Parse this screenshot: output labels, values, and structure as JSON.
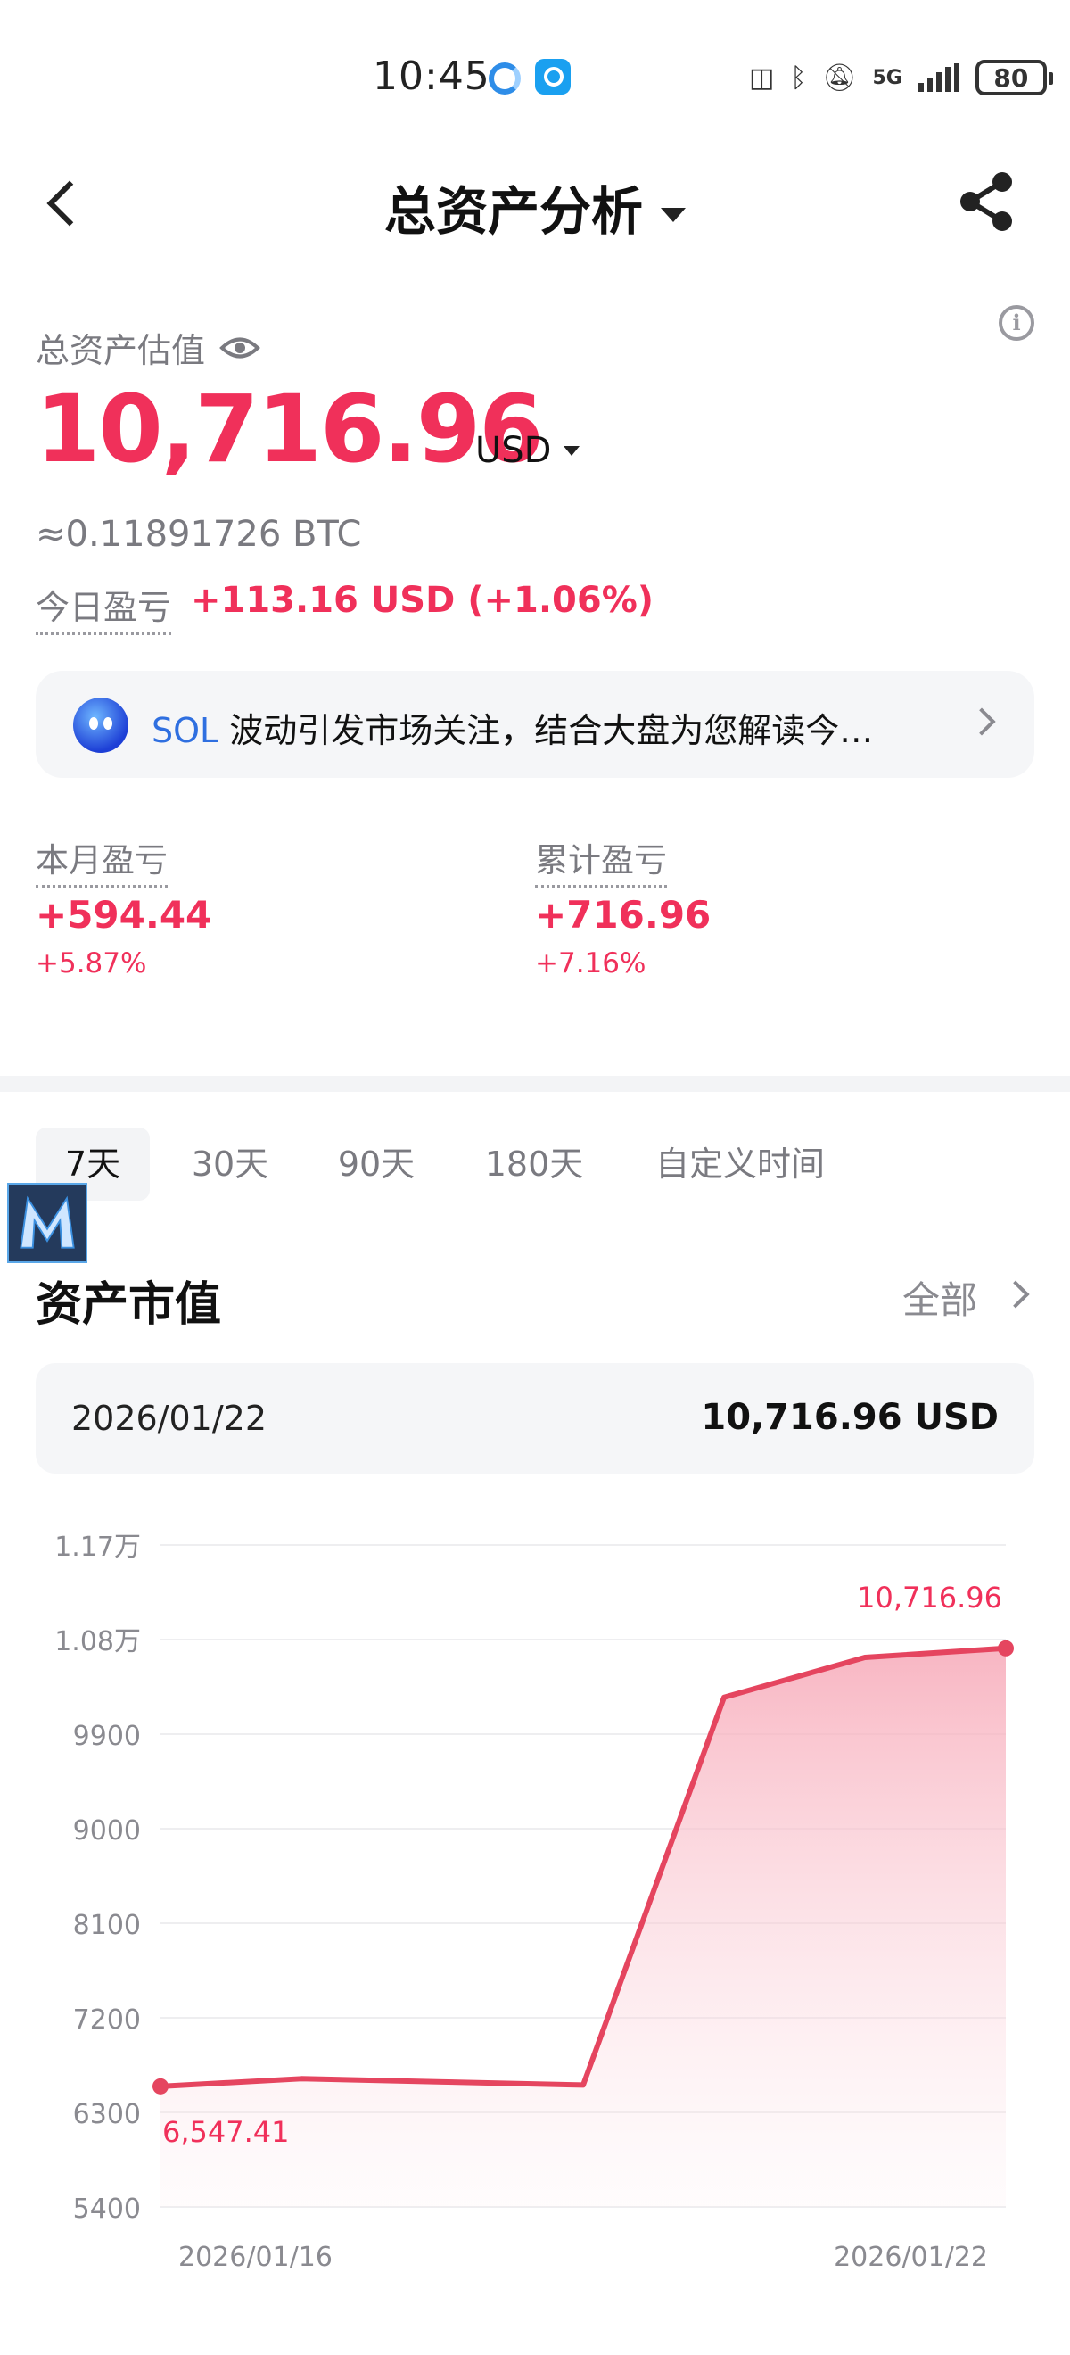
{
  "status_bar": {
    "time": "10:45",
    "network": "5G",
    "battery": "80"
  },
  "header": {
    "title": "总资产分析"
  },
  "summary": {
    "label": "总资产估值",
    "value": "10,716.96",
    "currency": "USD",
    "btc_equivalent": "≈0.11891726 BTC",
    "today_label": "今日盈亏",
    "today_value": "+113.16 USD (+1.06%)"
  },
  "ai_banner": {
    "coin": "SOL",
    "text": " 波动引发市场关注，结合大盘为您解读今…"
  },
  "pnl": {
    "month": {
      "label": "本月盈亏",
      "value": "+594.44",
      "percent": "+5.87%"
    },
    "total": {
      "label": "累计盈亏",
      "value": "+716.96",
      "percent": "+7.16%"
    }
  },
  "tabs": [
    "7天",
    "30天",
    "90天",
    "180天",
    "自定义时间"
  ],
  "active_tab": 0,
  "section": {
    "title": "资产市值",
    "all_label": "全部"
  },
  "selected_point": {
    "date": "2026/01/22",
    "value": "10,716.96 USD"
  },
  "colors": {
    "accent": "#f0305a",
    "line": "#e5455f",
    "area": "#fbc5cf"
  },
  "chart_data": {
    "type": "area",
    "x": [
      "2026/01/16",
      "2026/01/17",
      "2026/01/18",
      "2026/01/19",
      "2026/01/20",
      "2026/01/21",
      "2026/01/22"
    ],
    "values": [
      6547.41,
      6620,
      6590,
      6560,
      10250,
      10630,
      10716.96
    ],
    "y_ticks": [
      {
        "value": 5400,
        "label": "5400"
      },
      {
        "value": 6300,
        "label": "6300"
      },
      {
        "value": 7200,
        "label": "7200"
      },
      {
        "value": 8100,
        "label": "8100"
      },
      {
        "value": 9000,
        "label": "9000"
      },
      {
        "value": 9900,
        "label": "9900"
      },
      {
        "value": 10800,
        "label": "1.08万"
      },
      {
        "value": 11700,
        "label": "1.17万"
      }
    ],
    "ylim": [
      5400,
      11700
    ],
    "x_tick_labels": [
      "2026/01/16",
      "2026/01/22"
    ],
    "annotations": {
      "min_label": "6,547.41",
      "max_label": "10,716.96"
    },
    "grid": true,
    "legend": "none"
  }
}
